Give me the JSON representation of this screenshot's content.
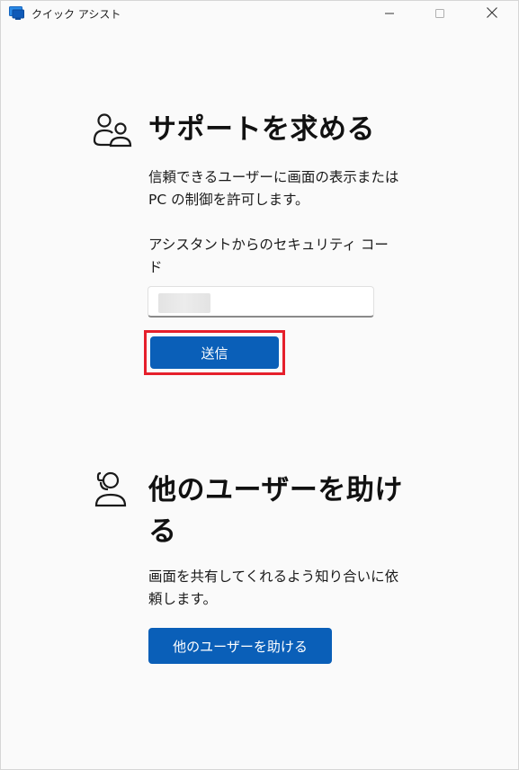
{
  "window": {
    "title": "クイック アシスト",
    "controls": [
      "minimize-icon",
      "maximize-icon",
      "close-icon"
    ]
  },
  "get_help": {
    "icon": "people-icon",
    "heading": "サポートを求める",
    "description_line1": "信頼できるユーザーに画面の表示または",
    "description_line2": "PC の制御を許可します。",
    "code_label_line1": "アシスタントからのセキュリティ コー",
    "code_label_line2": "ド",
    "code_value": "",
    "submit_label": "送信"
  },
  "give_help": {
    "icon": "person-headset-icon",
    "heading_line1": "他のユーザーを助け",
    "heading_line2": "る",
    "description_line1": "画面を共有してくれるよう知り合いに依",
    "description_line2": "頼します。",
    "button_label": "他のユーザーを助ける"
  },
  "colors": {
    "accent": "#0a5fb8",
    "highlight_border": "#e51f2b",
    "background": "#fafafa"
  }
}
